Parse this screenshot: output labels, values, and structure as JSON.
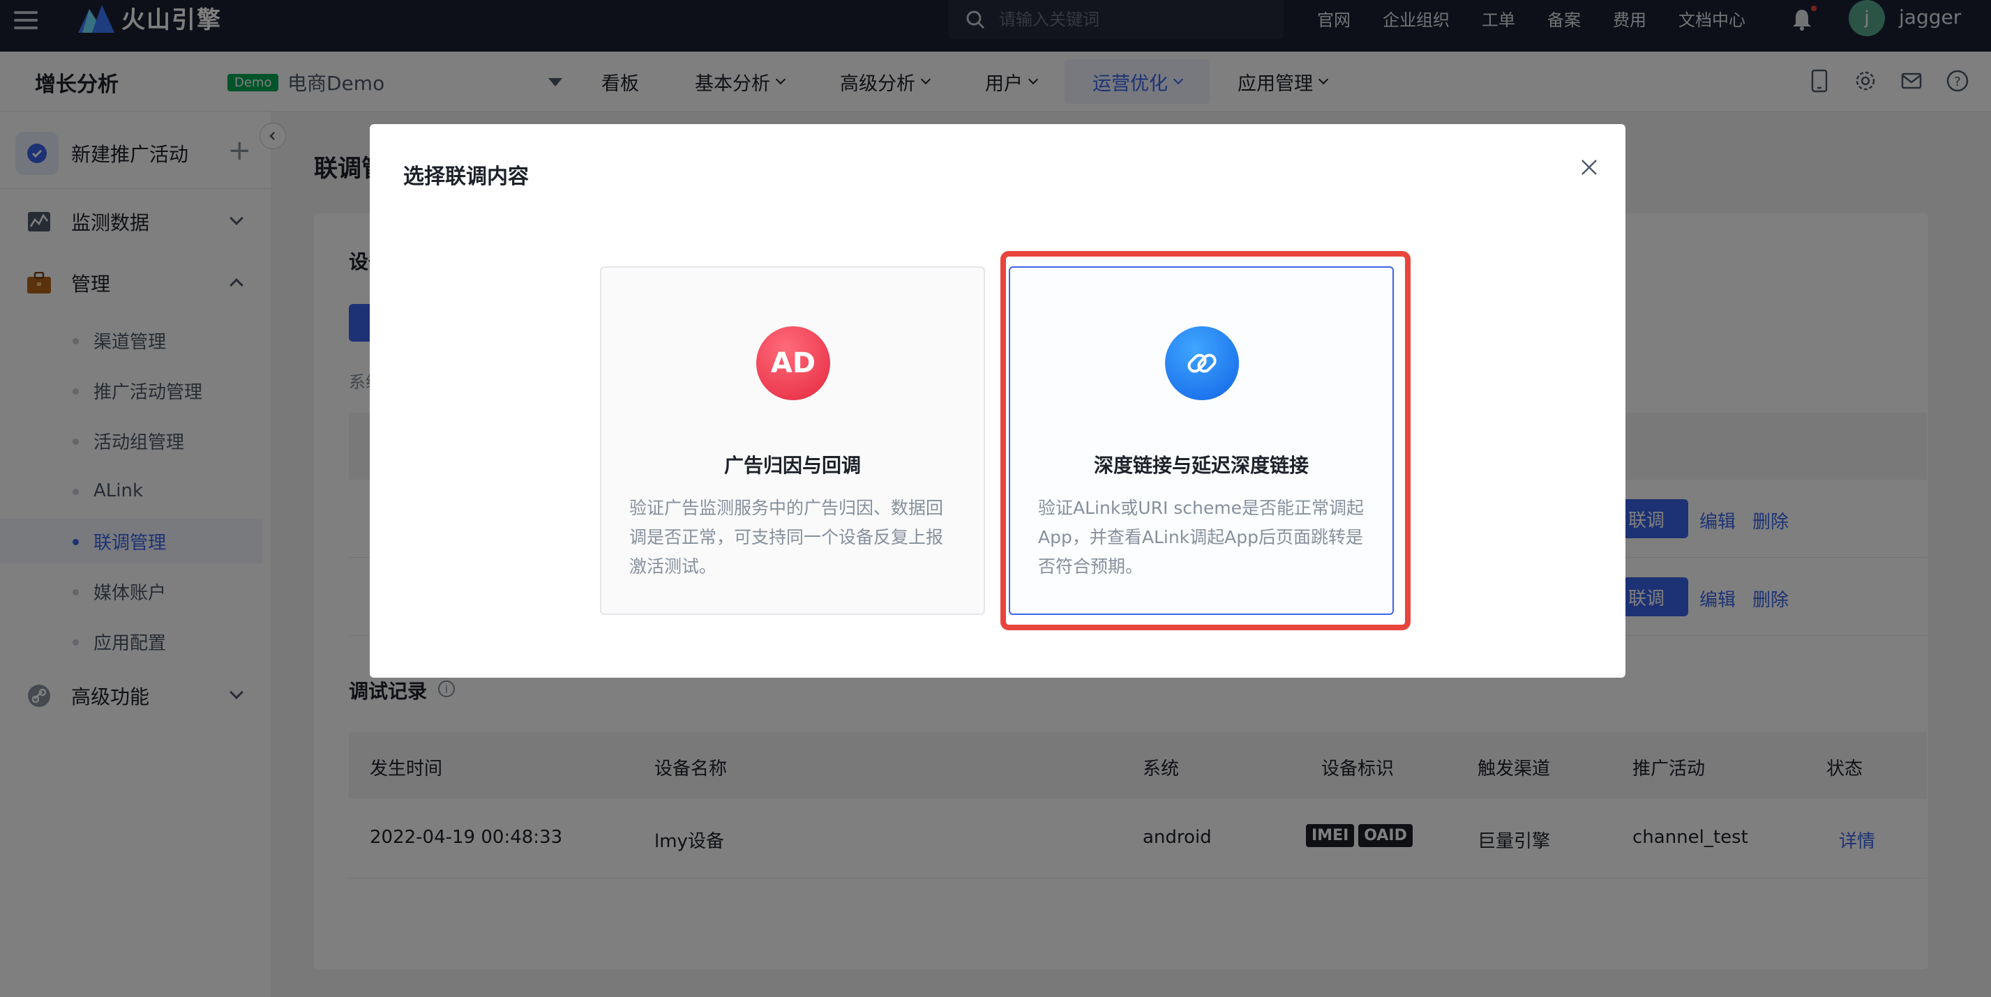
{
  "topbar": {
    "brand": "火山引擎",
    "search_placeholder": "请输入关键词",
    "nav": [
      "官网",
      "企业组织",
      "工单",
      "备案",
      "费用",
      "文档中心"
    ],
    "avatar_initial": "j",
    "username": "jagger"
  },
  "secbar": {
    "product": "增长分析",
    "demo_tag": "Demo",
    "app_name": "电商Demo",
    "nav": [
      {
        "label": "看板",
        "has_menu": false
      },
      {
        "label": "基本分析",
        "has_menu": true
      },
      {
        "label": "高级分析",
        "has_menu": true
      },
      {
        "label": "用户",
        "has_menu": true
      },
      {
        "label": "运营优化",
        "has_menu": true,
        "active": true
      },
      {
        "label": "应用管理",
        "has_menu": true
      }
    ]
  },
  "sidebar": {
    "new_activity": "新建推广活动",
    "groups": [
      {
        "label": "监测数据",
        "expanded": false
      },
      {
        "label": "管理",
        "expanded": true
      },
      {
        "label": "高级功能",
        "expanded": false
      }
    ],
    "items": [
      "渠道管理",
      "推广活动管理",
      "活动组管理",
      "ALink",
      "联调管理",
      "媒体账户",
      "应用配置"
    ],
    "active_item": "联调管理"
  },
  "main": {
    "title": "联调管理",
    "section_title": "设备",
    "hint": "系统",
    "rows": [
      {
        "action": "联调",
        "edit": "编辑",
        "delete": "删除"
      },
      {
        "action": "联调",
        "edit": "编辑",
        "delete": "删除"
      }
    ],
    "records_title": "调试记录",
    "columns": [
      "发生时间",
      "设备名称",
      "系统",
      "设备标识",
      "触发渠道",
      "推广活动",
      "状态"
    ],
    "record": {
      "time": "2022-04-19 00:48:33",
      "device": "lmy设备",
      "os": "android",
      "ids": [
        "IMEI",
        "OAID"
      ],
      "channel": "巨量引擎",
      "campaign": "channel_test",
      "status": "详情"
    }
  },
  "modal": {
    "title": "选择联调内容",
    "options": [
      {
        "icon_text": "AD",
        "title": "广告归因与回调",
        "description": "验证广告监测服务中的广告归因、数据回调是否正常，可支持同一个设备反复上报激活测试。"
      },
      {
        "icon": "link-icon",
        "title": "深度链接与延迟深度链接",
        "description": "验证ALink或URI scheme是否能正常调起App，并查看ALink调起App后页面跳转是否符合预期。"
      }
    ]
  },
  "colors": {
    "topbar_bg": "#1b2033",
    "accent": "#3a65e8",
    "highlight": "#e8453c",
    "demo_tag": "#00a854"
  }
}
